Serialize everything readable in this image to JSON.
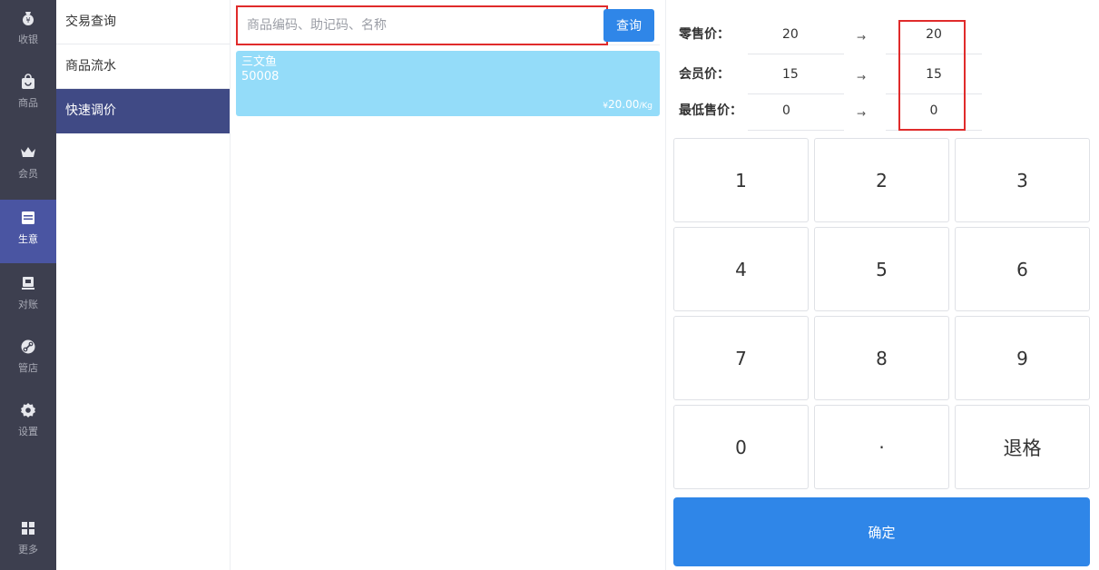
{
  "nav": {
    "items": [
      {
        "label": "收银",
        "icon": "cash-register-icon"
      },
      {
        "label": "商品",
        "icon": "shopping-bag-icon"
      },
      {
        "label": "会员",
        "icon": "crown-icon"
      },
      {
        "label": "生意",
        "icon": "ledger-icon"
      },
      {
        "label": "对账",
        "icon": "reconcile-icon"
      },
      {
        "label": "管店",
        "icon": "store-link-icon"
      },
      {
        "label": "设置",
        "icon": "gear-icon"
      },
      {
        "label": "更多",
        "icon": "grid-icon"
      }
    ],
    "active_index": 3
  },
  "sub_menu": {
    "items": [
      "交易查询",
      "商品流水",
      "快速调价"
    ],
    "active_index": 2
  },
  "search": {
    "placeholder": "商品编码、助记码、名称",
    "value": "",
    "button_label": "查询"
  },
  "products": [
    {
      "name": "三文鱼",
      "code": "50008",
      "currency": "¥",
      "price": "20.00",
      "unit": "/Kg"
    }
  ],
  "price_editor": {
    "rows": [
      {
        "label": "零售价：",
        "old": "20",
        "arrow": "→",
        "new": "20"
      },
      {
        "label": "会员价：",
        "old": "15",
        "arrow": "→",
        "new": "15"
      },
      {
        "label": "最低售价：",
        "old": "0",
        "arrow": "→",
        "new": "0"
      }
    ]
  },
  "keypad": {
    "keys": [
      "1",
      "2",
      "3",
      "4",
      "5",
      "6",
      "7",
      "8",
      "9",
      "0",
      "·",
      "退格"
    ],
    "confirm_label": "确定"
  },
  "colors": {
    "nav_bg": "#3d3f4f",
    "nav_active": "#4a55a2",
    "submenu_active": "#404a85",
    "accent": "#2f86e8",
    "product_card": "#94dcf9",
    "highlight": "#e02b2b"
  }
}
